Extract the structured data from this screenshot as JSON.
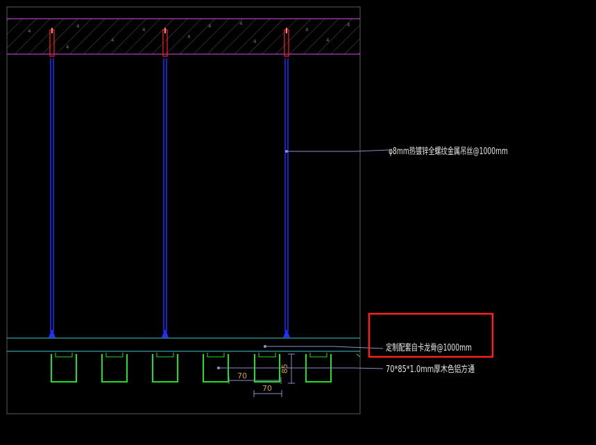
{
  "annotations": {
    "hanger": "φ8mm热镀锌全螺纹金属吊丝@1000mm",
    "keel": "定制配套自卡龙骨@1000mm",
    "tube": "70*85*1.0mm厚木色铝方通"
  },
  "dimensions": {
    "width_a": "70",
    "width_b": "70",
    "height": "85"
  },
  "colors": {
    "background": "#000000",
    "slab": "#b040c0",
    "rod": "#2030ff",
    "anchor": "#ff2020",
    "profile": "#20e020",
    "keel": "#40c8c8",
    "leader": "#8890c8",
    "highlight": "#ff2020"
  }
}
